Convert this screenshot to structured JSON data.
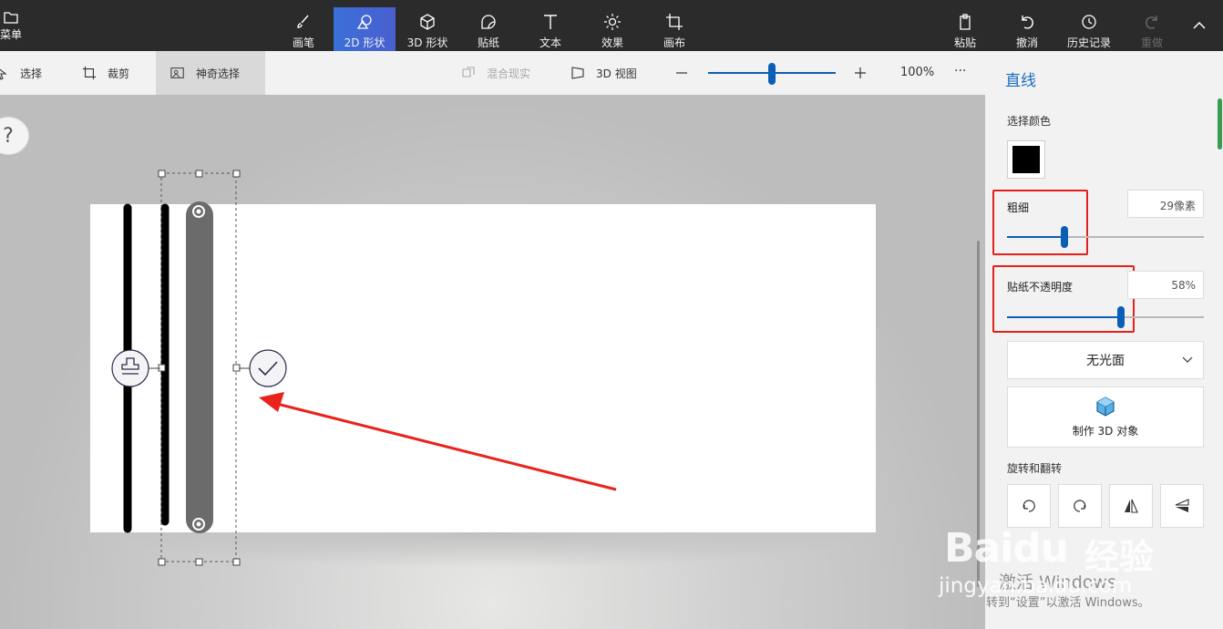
{
  "toolbar": {
    "menu": "菜单",
    "tools": [
      {
        "label": "画笔",
        "icon": "brush-icon"
      },
      {
        "label": "2D 形状",
        "icon": "2d-shapes-icon"
      },
      {
        "label": "3D 形状",
        "icon": "3d-shapes-icon"
      },
      {
        "label": "贴纸",
        "icon": "stickers-icon"
      },
      {
        "label": "文本",
        "icon": "text-icon"
      },
      {
        "label": "效果",
        "icon": "effects-icon"
      },
      {
        "label": "画布",
        "icon": "canvas-icon"
      }
    ],
    "active_tool": "2D 形状",
    "paste": "粘贴",
    "undo": "撤消",
    "history": "历史记录",
    "redo": "重做",
    "accent": "#3b6fd8"
  },
  "subbar": {
    "select": "选择",
    "crop": "裁剪",
    "magic_select": "神奇选择",
    "mixed_reality": "混合现实",
    "view_3d": "3D 视图",
    "zoom": "100%",
    "more": "···"
  },
  "workspace": {
    "help": "?"
  },
  "panel": {
    "title": "直线",
    "select_color_label": "选择颜色",
    "color": "#000000",
    "thickness_label": "粗细",
    "thickness_value": "29像素",
    "thickness_fraction": 0.29,
    "opacity_label": "贴纸不透明度",
    "opacity_value": "58%",
    "opacity_fraction": 0.58,
    "finish_value": "无光面",
    "make3d_label": "制作 3D 对象",
    "rotate_label": "旋转和翻转"
  },
  "watermark": {
    "logo": "Baidu",
    "logo_cn": "经验",
    "url": "jingyan.baidu.com",
    "activate_title": "激活 Windows",
    "activate_sub": "转到“设置”以激活 Windows。"
  }
}
